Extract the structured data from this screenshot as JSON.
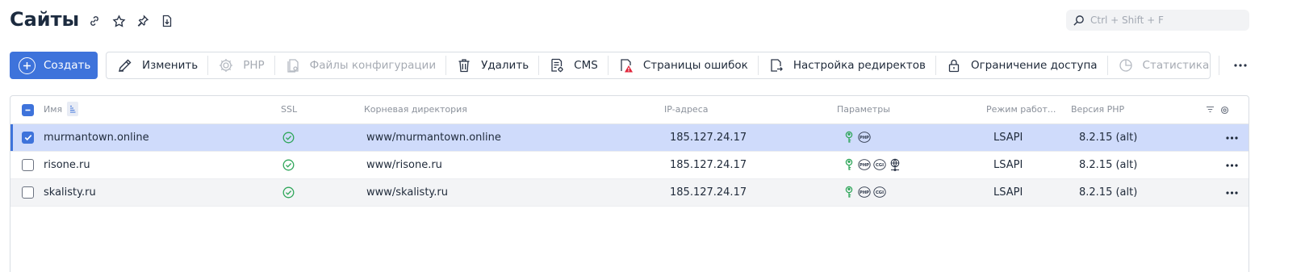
{
  "header": {
    "title": "Сайты",
    "icons": [
      "link-icon",
      "star-icon",
      "pin-icon",
      "download-icon"
    ]
  },
  "search": {
    "placeholder": "Ctrl + Shift + F",
    "value": ""
  },
  "toolbar": {
    "create_label": "Создать",
    "items": [
      {
        "label": "Изменить",
        "icon": "pencil-icon",
        "enabled": true
      },
      {
        "label": "PHP",
        "icon": "gear-icon",
        "enabled": false
      },
      {
        "label": "Файлы конфигурации",
        "icon": "config-files-icon",
        "enabled": false
      },
      {
        "label": "Удалить",
        "icon": "trash-icon",
        "enabled": true
      },
      {
        "label": "CMS",
        "icon": "cms-icon",
        "enabled": true
      },
      {
        "label": "Страницы ошибок",
        "icon": "error-pages-icon",
        "enabled": true
      },
      {
        "label": "Настройка редиректов",
        "icon": "redirect-icon",
        "enabled": true
      },
      {
        "label": "Ограничение доступа",
        "icon": "lock-icon",
        "enabled": true
      },
      {
        "label": "Статистика",
        "icon": "pie-chart-icon",
        "enabled": false
      }
    ],
    "more_icon": "more-horizontal-icon"
  },
  "table": {
    "columns": [
      "Имя",
      "SSL",
      "Корневая директория",
      "IP-адреса",
      "Параметры",
      "Режим работ...",
      "Версия PHP"
    ],
    "rows": [
      {
        "name": "murmantown.online",
        "ssl": "ok",
        "root": "www/murmantown.online",
        "ip": "185.127.24.17",
        "params": [
          "ssl-key-icon",
          "php-icon"
        ],
        "mode": "LSAPI",
        "php": "8.2.15 (alt)",
        "selected": true
      },
      {
        "name": "risone.ru",
        "ssl": "ok",
        "root": "www/risone.ru",
        "ip": "185.127.24.17",
        "params": [
          "ssl-key-icon",
          "php-icon",
          "cgi-icon",
          "network-icon"
        ],
        "mode": "LSAPI",
        "php": "8.2.15 (alt)",
        "selected": false
      },
      {
        "name": "skalisty.ru",
        "ssl": "ok",
        "root": "www/skalisty.ru",
        "ip": "185.127.24.17",
        "params": [
          "ssl-key-icon",
          "php-icon",
          "cgi-icon"
        ],
        "mode": "LSAPI",
        "php": "8.2.15 (alt)",
        "selected": false
      }
    ]
  },
  "colors": {
    "accent": "#3e73db",
    "selected_row": "#cfdbfb",
    "ssl_ok": "#2fa65a"
  }
}
